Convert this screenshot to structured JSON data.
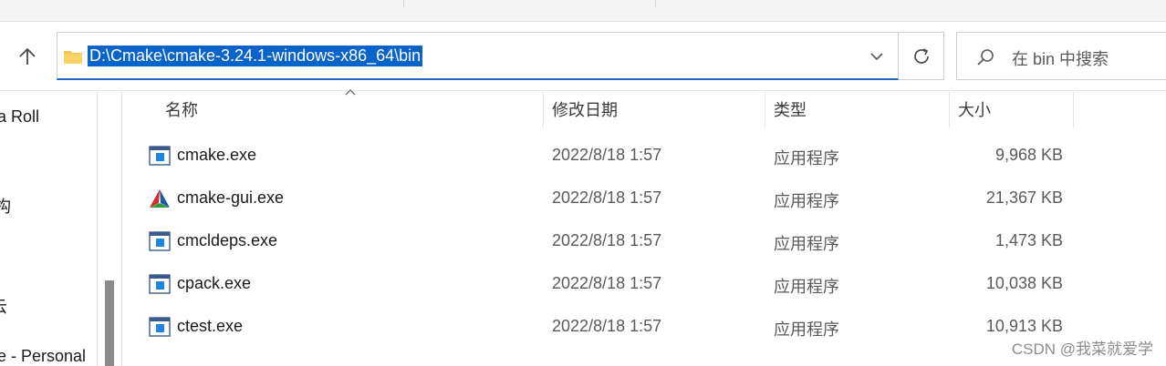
{
  "address": {
    "path": "D:\\Cmake\\cmake-3.24.1-windows-x86_64\\bin"
  },
  "search": {
    "placeholder": "在 bin 中搜索"
  },
  "sidebar": {
    "items": [
      {
        "label": "a Roll"
      },
      {
        "label": "构"
      },
      {
        "label": "云"
      },
      {
        "label": "e - Personal"
      }
    ]
  },
  "columns": {
    "name": "名称",
    "date": "修改日期",
    "type": "类型",
    "size": "大小"
  },
  "files": [
    {
      "name": "cmake.exe",
      "date": "2022/8/18 1:57",
      "type": "应用程序",
      "size": "9,968 KB",
      "icon": "exe-icon"
    },
    {
      "name": "cmake-gui.exe",
      "date": "2022/8/18 1:57",
      "type": "应用程序",
      "size": "21,367 KB",
      "icon": "cmake-logo-icon"
    },
    {
      "name": "cmcldeps.exe",
      "date": "2022/8/18 1:57",
      "type": "应用程序",
      "size": "1,473 KB",
      "icon": "exe-icon"
    },
    {
      "name": "cpack.exe",
      "date": "2022/8/18 1:57",
      "type": "应用程序",
      "size": "10,038 KB",
      "icon": "exe-icon"
    },
    {
      "name": "ctest.exe",
      "date": "2022/8/18 1:57",
      "type": "应用程序",
      "size": "10,913 KB",
      "icon": "exe-icon"
    }
  ],
  "watermark": "CSDN @我菜就爱学",
  "colors": {
    "selection": "#0a63c9",
    "accent_underline": "#1a66c2",
    "folder": "#f4c247"
  }
}
